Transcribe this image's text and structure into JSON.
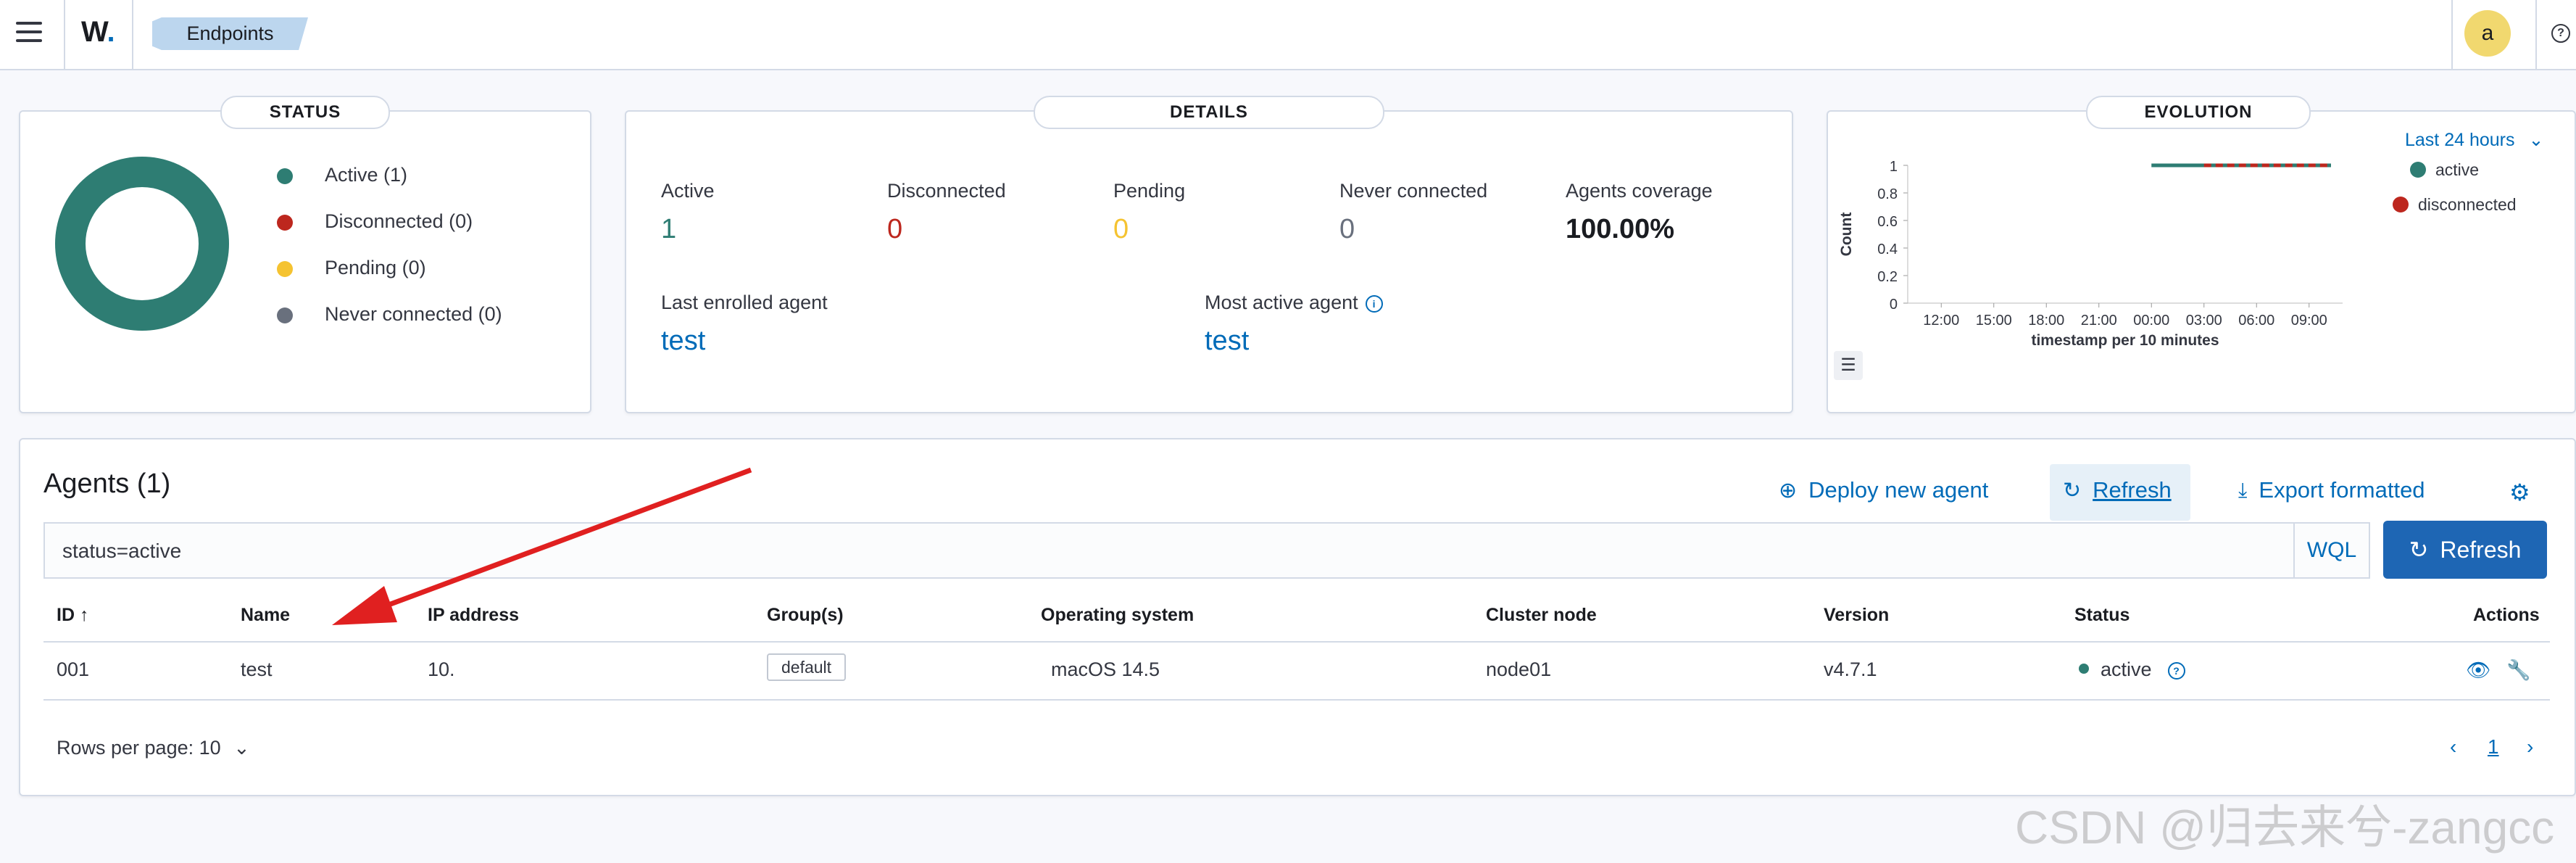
{
  "header": {
    "logo": "W",
    "logo_dot": ".",
    "breadcrumb": "Endpoints",
    "avatar": "a",
    "help": "?"
  },
  "status_panel": {
    "title": "STATUS",
    "legend": [
      {
        "label": "Active (1)",
        "color": "#2e7d73"
      },
      {
        "label": "Disconnected (0)",
        "color": "#bd271e"
      },
      {
        "label": "Pending (0)",
        "color": "#f5c331"
      },
      {
        "label": "Never connected (0)",
        "color": "#69707d"
      }
    ]
  },
  "details_panel": {
    "title": "DETAILS",
    "stats": [
      {
        "label": "Active",
        "value": "1",
        "color": "#2e7d73"
      },
      {
        "label": "Disconnected",
        "value": "0",
        "color": "#bd271e"
      },
      {
        "label": "Pending",
        "value": "0",
        "color": "#f5c331"
      },
      {
        "label": "Never connected",
        "value": "0",
        "color": "#69707d"
      },
      {
        "label": "Agents coverage",
        "value": "100.00%",
        "color": "#1a1c21"
      }
    ],
    "last_enrolled_label": "Last enrolled agent",
    "last_enrolled_value": "test",
    "most_active_label": "Most active agent",
    "most_active_value": "test"
  },
  "evolution_panel": {
    "title": "EVOLUTION",
    "range": "Last 24 hours"
  },
  "chart_data": {
    "type": "line",
    "title": "",
    "xlabel": "timestamp per 10 minutes",
    "ylabel": "Count",
    "ylim": [
      0,
      1
    ],
    "yticks": [
      "0",
      "0.2",
      "0.4",
      "0.6",
      "0.8",
      "1"
    ],
    "xticks": [
      "12:00",
      "15:00",
      "18:00",
      "21:00",
      "00:00",
      "03:00",
      "06:00",
      "09:00"
    ],
    "series": [
      {
        "name": "active",
        "color": "#2e7d73",
        "from": "00:00",
        "to": "10:40",
        "value": 1
      },
      {
        "name": "disconnected",
        "color": "#bd271e",
        "from": "03:00",
        "to": "10:40",
        "value": 1
      }
    ],
    "legend_position": "top-right"
  },
  "agents": {
    "title": "Agents (1)",
    "deploy": "Deploy new agent",
    "refresh_link": "Refresh",
    "export": "Export formatted",
    "search_value": "status=active",
    "wql": "WQL",
    "refresh_button": "Refresh",
    "columns": [
      "ID",
      "Name",
      "IP address",
      "Group(s)",
      "Operating system",
      "Cluster node",
      "Version",
      "Status",
      "Actions"
    ],
    "sort_indicator": "↑",
    "row": {
      "id": "001",
      "name": "test",
      "ip": "10.",
      "group": "default",
      "os": "macOS 14.5",
      "cluster": "node01",
      "version": "v4.7.1",
      "status": "active"
    },
    "rows_per_page": "Rows per page: 10",
    "page": "1"
  },
  "watermark": "CSDN @归去来兮-zangcc"
}
